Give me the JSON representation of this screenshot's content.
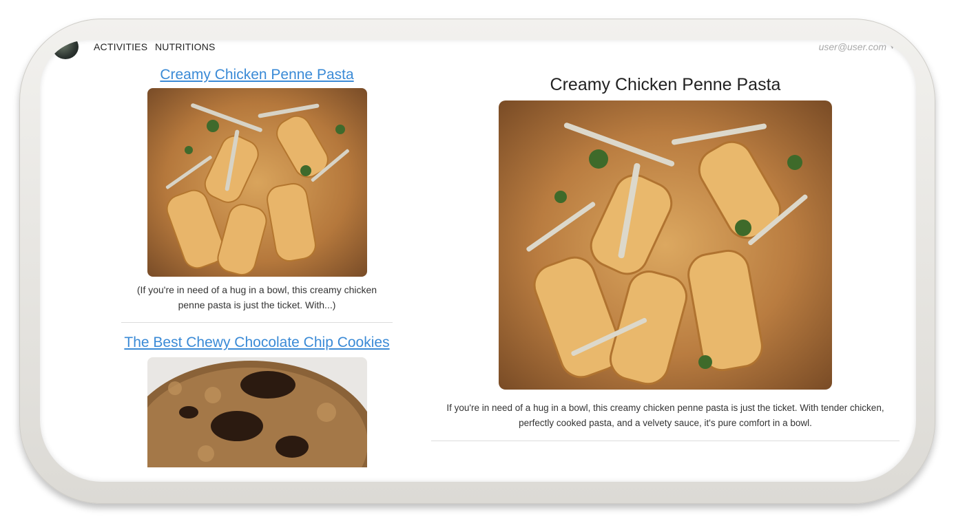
{
  "nav": {
    "links": [
      "ACTIVITIES",
      "NUTRITIONS"
    ],
    "user_email": "user@user.com"
  },
  "recipe_list": [
    {
      "title": "Creamy Chicken Penne Pasta",
      "excerpt": "(If you're in need of a hug in a bowl, this creamy chicken penne pasta is just the ticket. With...)",
      "image": "penne-pasta-photo"
    },
    {
      "title": "The Best Chewy Chocolate Chip Cookies",
      "image": "chocolate-chip-cookie-photo"
    }
  ],
  "detail": {
    "title": "Creamy Chicken Penne Pasta",
    "image": "penne-pasta-photo",
    "description": "If you're in need of a hug in a bowl, this creamy chicken penne pasta is just the ticket. With tender chicken, perfectly cooked pasta, and a velvety sauce, it's pure comfort in a bowl."
  },
  "colors": {
    "link": "#3a8ad6",
    "frame": "#dcdad5"
  }
}
